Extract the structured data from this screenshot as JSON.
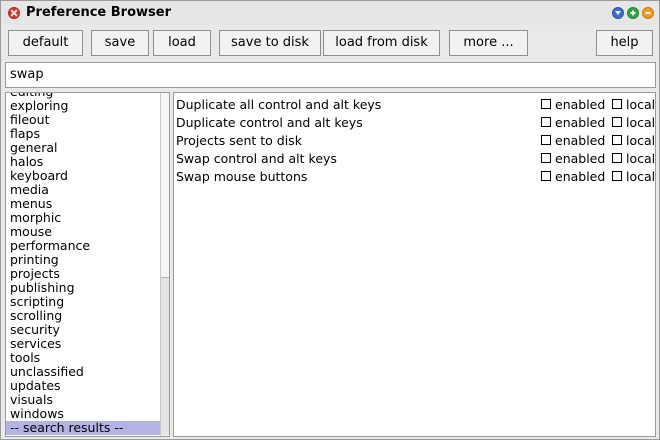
{
  "window": {
    "title": "Preference Browser"
  },
  "toolbar": {
    "default_label": "default",
    "save_label": "save",
    "load_label": "load",
    "save_to_disk_label": "save to disk",
    "load_from_disk_label": "load from disk",
    "more_label": "more ...",
    "help_label": "help"
  },
  "search": {
    "value": "swap"
  },
  "categories": {
    "items": [
      "editing",
      "exploring",
      "fileout",
      "flaps",
      "general",
      "halos",
      "keyboard",
      "media",
      "menus",
      "morphic",
      "mouse",
      "performance",
      "printing",
      "projects",
      "publishing",
      "scripting",
      "scrolling",
      "security",
      "services",
      "tools",
      "unclassified",
      "updates",
      "visuals",
      "windows",
      "-- search results --"
    ],
    "selected": "-- search results --"
  },
  "preferences": {
    "enabled_label": "enabled",
    "local_label": "local",
    "rows": [
      {
        "name": "Duplicate all control and alt keys",
        "enabled": false,
        "local": false
      },
      {
        "name": "Duplicate control and alt keys",
        "enabled": false,
        "local": false
      },
      {
        "name": "Projects sent to disk",
        "enabled": false,
        "local": false
      },
      {
        "name": "Swap control and alt keys",
        "enabled": false,
        "local": false
      },
      {
        "name": "Swap mouse buttons",
        "enabled": false,
        "local": false
      }
    ]
  },
  "colors": {
    "selection": "#b3b3e6",
    "close": "#d83a32",
    "menu": "#3b6fcf",
    "grow": "#35a341",
    "collapse": "#ef9b1d"
  }
}
